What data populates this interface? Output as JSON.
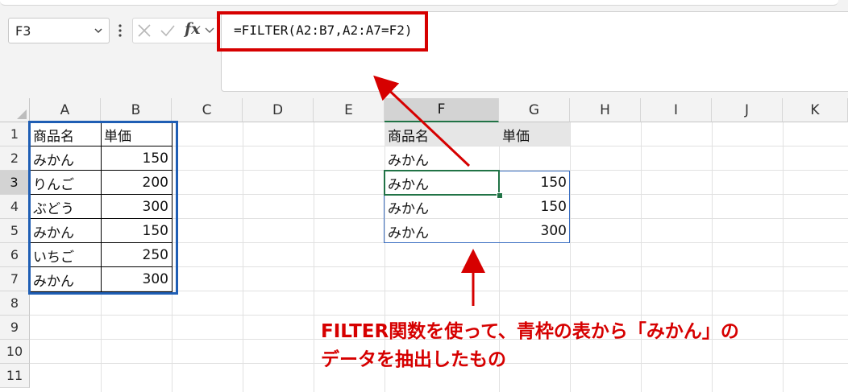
{
  "name_box": {
    "value": "F3"
  },
  "formula_bar": {
    "fx_label": "fx",
    "formula": "=FILTER(A2:B7,A2:A7=F2)"
  },
  "columns": [
    "A",
    "B",
    "C",
    "D",
    "E",
    "F",
    "G",
    "H",
    "I",
    "J",
    "K"
  ],
  "rows": [
    "1",
    "2",
    "3",
    "4",
    "5",
    "6",
    "7",
    "8",
    "9",
    "10",
    "11"
  ],
  "selected_cell": {
    "column": "F",
    "row": "3"
  },
  "source_table": {
    "headers": [
      "商品名",
      "単価"
    ],
    "rows": [
      [
        "みかん",
        "150"
      ],
      [
        "りんご",
        "200"
      ],
      [
        "ぶどう",
        "300"
      ],
      [
        "みかん",
        "150"
      ],
      [
        "いちご",
        "250"
      ],
      [
        "みかん",
        "300"
      ]
    ]
  },
  "criteria_table": {
    "headers": [
      "商品名",
      "単価"
    ],
    "criteria": "みかん"
  },
  "result_table": {
    "rows": [
      [
        "みかん",
        "150"
      ],
      [
        "みかん",
        "150"
      ],
      [
        "みかん",
        "300"
      ]
    ]
  },
  "annotation": {
    "line1": "FILTER関数を使って、青枠の表から「みかん」の",
    "line2": "データを抽出したもの"
  },
  "colors": {
    "annotation_red": "#d60000",
    "source_table_blue": "#1f5eb4",
    "selection_green": "#217346"
  }
}
